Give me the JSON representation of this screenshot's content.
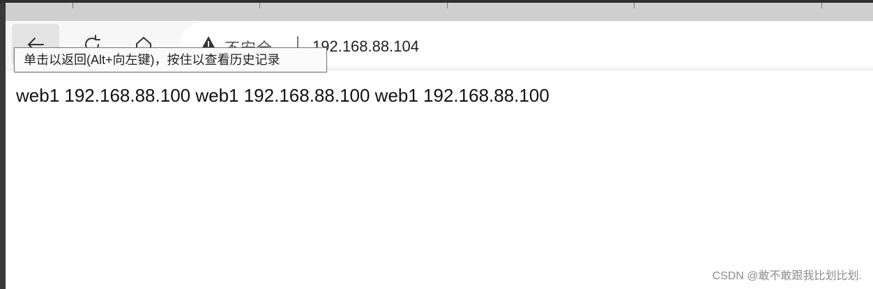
{
  "browser": {
    "address_bar": {
      "security_label": "不安全",
      "url": "192.168.88.104"
    },
    "back_button": {
      "tooltip": "单击以返回(Alt+向左键)，按住以查看历史记录"
    }
  },
  "page": {
    "text": "web1 192.168.88.100 web1 192.168.88.100 web1 192.168.88.100"
  },
  "watermark": "CSDN @敢不敢跟我比划比划."
}
